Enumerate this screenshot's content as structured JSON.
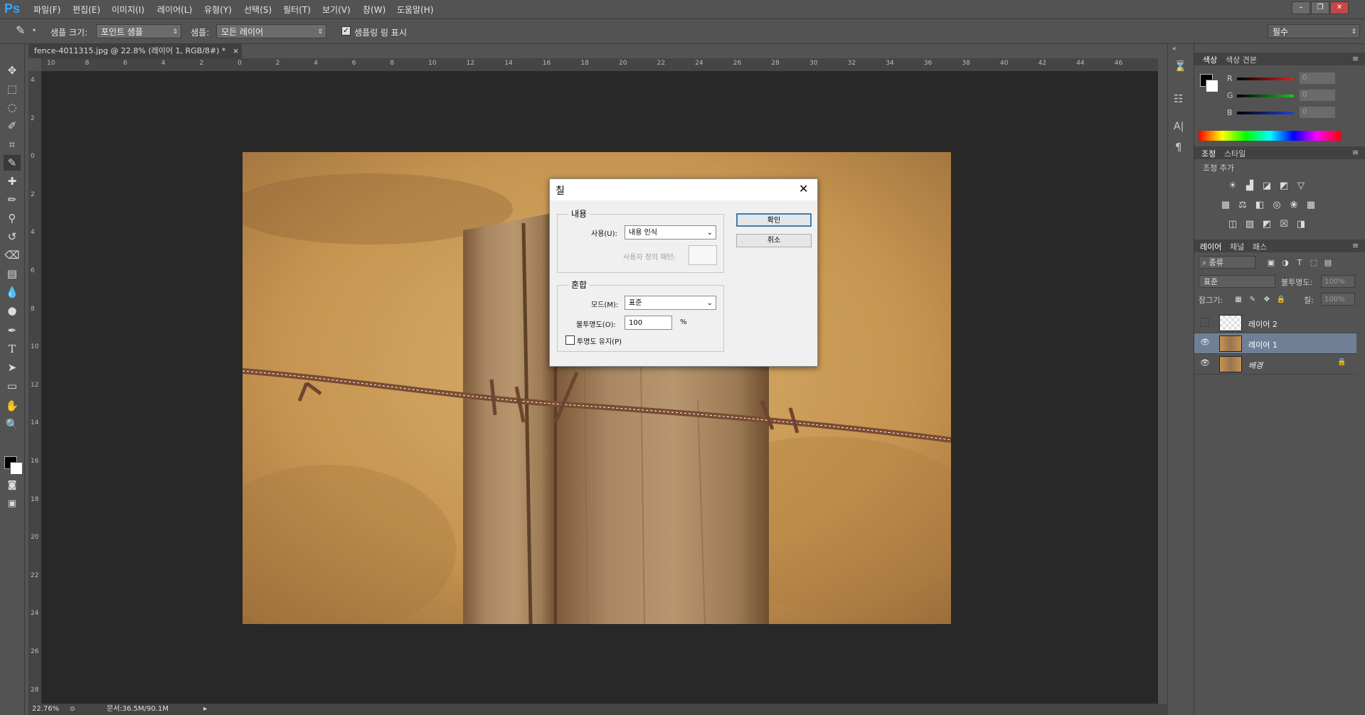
{
  "app": {
    "logo": "Ps"
  },
  "menu": [
    "파일(F)",
    "편집(E)",
    "이미지(I)",
    "레이어(L)",
    "유형(Y)",
    "선택(S)",
    "필터(T)",
    "보기(V)",
    "창(W)",
    "도움말(H)"
  ],
  "options": {
    "sample_size_label": "샘플 크기:",
    "sample_size_value": "포인트 샘플",
    "sample_label": "샘플:",
    "sample_value": "모든 레이어",
    "ring_label": "샘플링 링 표시",
    "workspace": "필수"
  },
  "document": {
    "tab_title": "fence-4011315.jpg @ 22.8% (레이어 1, RGB/8#) *",
    "zoom": "22.76%",
    "doc_size": "문서:36.5M/90.1M"
  },
  "ruler_top": [
    "10",
    "8",
    "6",
    "4",
    "2",
    "0",
    "2",
    "4",
    "6",
    "8",
    "10",
    "12",
    "14",
    "16",
    "18",
    "20",
    "22",
    "24",
    "26",
    "28",
    "30",
    "32",
    "34",
    "36",
    "38",
    "40",
    "42",
    "44",
    "46"
  ],
  "ruler_left": [
    "4",
    "2",
    "0",
    "2",
    "4",
    "6",
    "8",
    "10",
    "12",
    "14",
    "16",
    "18",
    "20",
    "22",
    "24",
    "26",
    "28"
  ],
  "dialog": {
    "title": "칠",
    "contents_legend": "내용",
    "use_label": "사용(U):",
    "use_value": "내용 인식",
    "custom_pattern_label": "사용자 정의 패턴:",
    "blending_legend": "혼합",
    "mode_label": "모드(M):",
    "mode_value": "표준",
    "opacity_label": "불투명도(O):",
    "opacity_value": "100",
    "opacity_unit": "%",
    "preserve_label": "투명도 유지(P)",
    "ok": "확인",
    "cancel": "취소"
  },
  "color_panel": {
    "tabs": [
      "색상",
      "색상 견본"
    ],
    "channels": [
      {
        "label": "R",
        "value": "0",
        "color": "#e02020"
      },
      {
        "label": "G",
        "value": "0",
        "color": "#20c020"
      },
      {
        "label": "B",
        "value": "0",
        "color": "#2040e0"
      }
    ]
  },
  "adjust_panel": {
    "tabs": [
      "조정",
      "스타일"
    ],
    "add_label": "조정 추가"
  },
  "layers_panel": {
    "tabs": [
      "레이어",
      "채널",
      "패스"
    ],
    "filter_label": "종류",
    "blend_mode": "표준",
    "opacity_label": "불투명도:",
    "opacity_value": "100%",
    "lock_label": "잠그기:",
    "fill_label": "칠:",
    "fill_value": "100%",
    "layers": [
      {
        "name": "레이어 2",
        "visible": false,
        "selected": false
      },
      {
        "name": "레이어 1",
        "visible": true,
        "selected": true
      },
      {
        "name": "배경",
        "visible": true,
        "selected": false,
        "locked": true
      }
    ]
  }
}
